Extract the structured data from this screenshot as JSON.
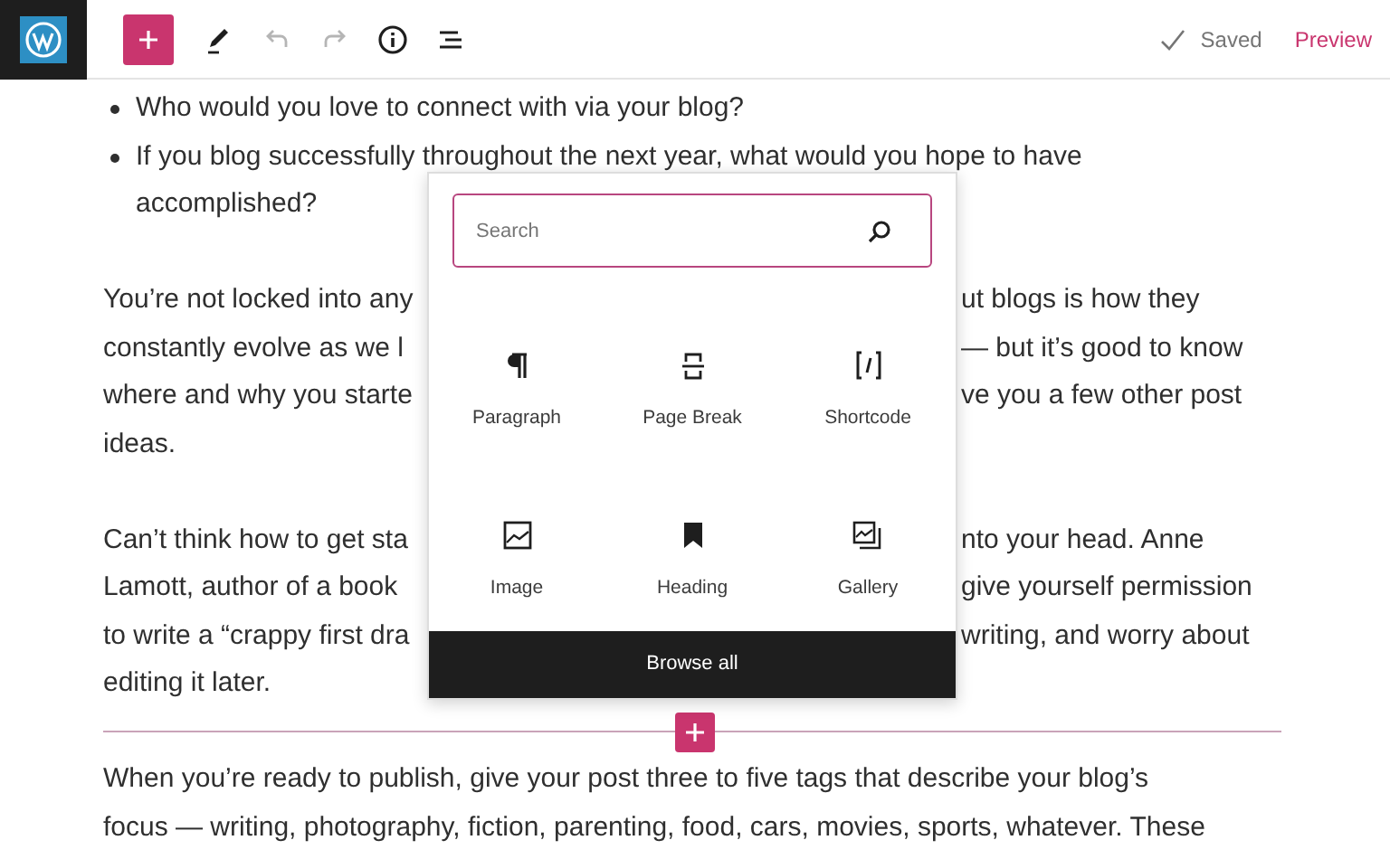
{
  "toolbar": {
    "tools": [
      {
        "kind": "add",
        "active": true,
        "disabled": false
      },
      {
        "kind": "edit",
        "active": false,
        "disabled": false
      },
      {
        "kind": "undo",
        "active": false,
        "disabled": true
      },
      {
        "kind": "redo",
        "active": false,
        "disabled": true
      },
      {
        "kind": "info",
        "active": false,
        "disabled": false
      },
      {
        "kind": "outline",
        "active": false,
        "disabled": false
      }
    ],
    "save_status": "Saved",
    "preview": "Preview"
  },
  "content": [
    {
      "kind": "list",
      "items": [
        {
          "lines": [
            "Who would you love to connect with via your blog?"
          ]
        },
        {
          "lines": [
            "If you blog successfully throughout the next year, what would you hope to have",
            "accomplished?"
          ]
        }
      ]
    },
    {
      "kind": "covered",
      "lines": [
        {
          "left": "You’re not locked into any",
          "right": "ut blogs is how they"
        },
        {
          "left": "constantly evolve as we l",
          "right": "— but it’s good to know"
        },
        {
          "left": "where and why you starte",
          "right": "ve you a few other post"
        },
        {
          "left": "ideas."
        }
      ]
    },
    {
      "kind": "covered",
      "lines": [
        {
          "left": "Can’t think how to get sta",
          "right": "nto your head. Anne"
        },
        {
          "left": "Lamott, author of a book",
          "right": "give yourself permission"
        },
        {
          "left": "to write a “crappy first dra",
          "right": "writing, and worry about"
        },
        {
          "left": "editing it later."
        }
      ]
    },
    {
      "kind": "inserter"
    },
    {
      "kind": "paragraph",
      "lines": [
        "When you’re ready to publish, give your post three to five tags that describe your blog’s",
        "focus — writing, photography, fiction, parenting, food, cars, movies, sports, whatever. These"
      ]
    }
  ],
  "inserter_popover": {
    "search": {
      "placeholder": "Search"
    },
    "blocks": [
      {
        "kind": "paragraph",
        "label": "Paragraph"
      },
      {
        "kind": "pagebreak",
        "label": "Page Break"
      },
      {
        "kind": "shortcode",
        "label": "Shortcode"
      },
      {
        "kind": "image",
        "label": "Image"
      },
      {
        "kind": "heading",
        "label": "Heading"
      },
      {
        "kind": "gallery",
        "label": "Gallery"
      }
    ],
    "browse": "Browse all"
  }
}
